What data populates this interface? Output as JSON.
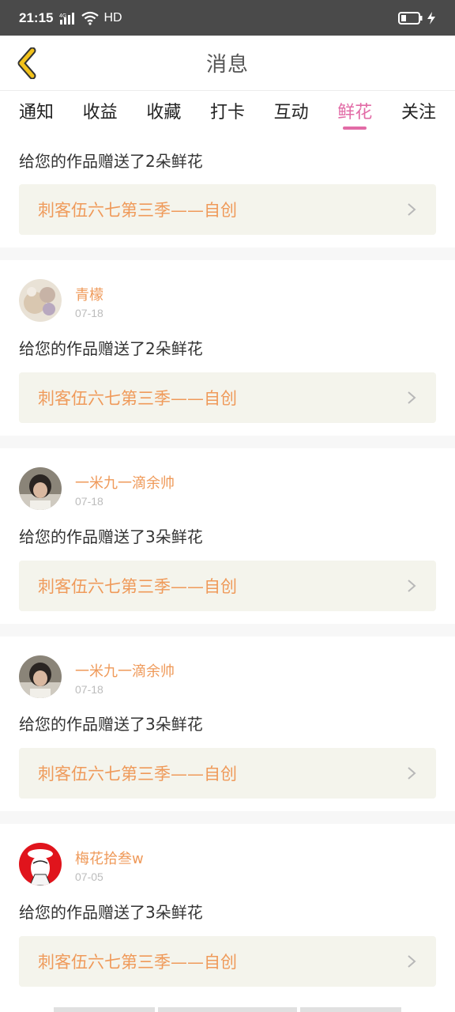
{
  "status_bar": {
    "time": "21:15",
    "network": "4G",
    "hd": "HD"
  },
  "header": {
    "title": "消息"
  },
  "tabs": [
    {
      "label": "通知",
      "active": false
    },
    {
      "label": "收益",
      "active": false
    },
    {
      "label": "收藏",
      "active": false
    },
    {
      "label": "打卡",
      "active": false
    },
    {
      "label": "互动",
      "active": false
    },
    {
      "label": "鲜花",
      "active": true
    },
    {
      "label": "关注",
      "active": false
    }
  ],
  "messages": [
    {
      "user": "",
      "date": "",
      "text": "给您的作品赠送了2朵鲜花",
      "work": "刺客伍六七第三季——自创"
    },
    {
      "user": "青檬",
      "date": "07-18",
      "text": "给您的作品赠送了2朵鲜花",
      "work": "刺客伍六七第三季——自创"
    },
    {
      "user": "一米九一滴余帅",
      "date": "07-18",
      "text": "给您的作品赠送了3朵鲜花",
      "work": "刺客伍六七第三季——自创"
    },
    {
      "user": "一米九一滴余帅",
      "date": "07-18",
      "text": "给您的作品赠送了3朵鲜花",
      "work": "刺客伍六七第三季——自创"
    },
    {
      "user": "梅花拾叁w",
      "date": "07-05",
      "text": "给您的作品赠送了3朵鲜花",
      "work": "刺客伍六七第三季——自创"
    }
  ],
  "colors": {
    "accent": "#e26ba6",
    "username": "#ef9a5a",
    "work_bg": "#f4f4ec",
    "back_icon": "#f2c21b"
  }
}
